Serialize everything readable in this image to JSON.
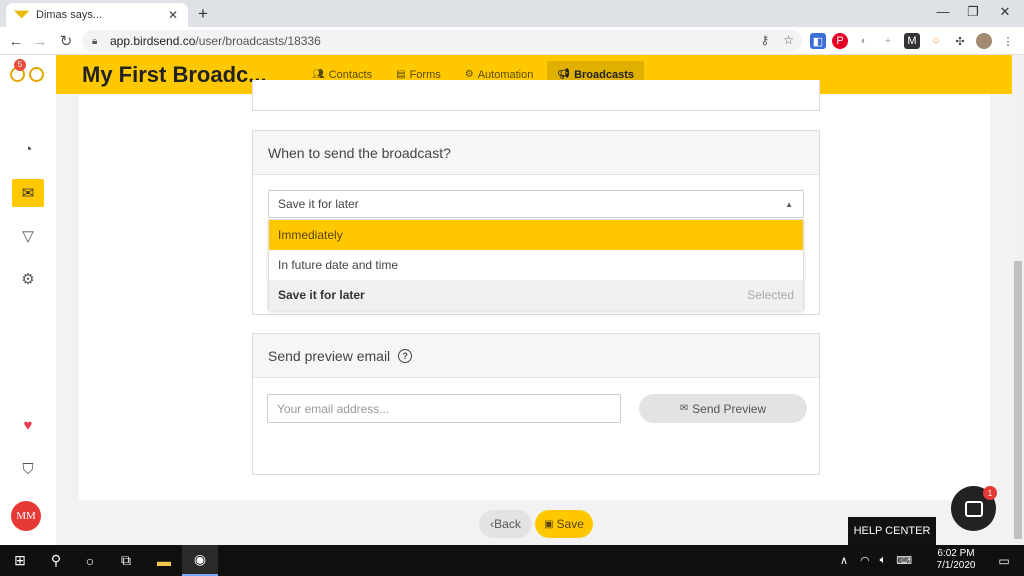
{
  "browser": {
    "tab_title": "Dimas says...",
    "tab_close": "✕",
    "new_tab": "+",
    "url_host": "app.birdsend.co",
    "url_path": "/user/broadcasts/18336",
    "window_controls": [
      "—",
      "❐",
      "✕"
    ]
  },
  "app": {
    "title": "My First Broadc...",
    "logo_badge": "5",
    "nav": [
      {
        "label": "Contacts",
        "icon": "contacts-icon",
        "active": false
      },
      {
        "label": "Forms",
        "icon": "forms-icon",
        "active": false
      },
      {
        "label": "Automation",
        "icon": "automation-icon",
        "active": false
      },
      {
        "label": "Broadcasts",
        "icon": "megaphone-icon",
        "active": true
      }
    ],
    "sidebar": {
      "icons": [
        "dashboard-icon",
        "mail-icon",
        "filter-icon",
        "settings-icon",
        "heart-icon",
        "shirt-icon"
      ],
      "avatar_initials": "MM"
    }
  },
  "schedule": {
    "heading": "When to send the broadcast?",
    "selected_value": "Save it for later",
    "options": [
      {
        "label": "Immediately",
        "state": "highlighted"
      },
      {
        "label": "In future date and time",
        "state": "normal"
      },
      {
        "label": "Save it for later",
        "state": "selected"
      }
    ],
    "selected_tag": "Selected"
  },
  "preview": {
    "heading": "Send preview email",
    "email_placeholder": "Your email address...",
    "send_button": "Send Preview"
  },
  "footer": {
    "back_label": "Back",
    "save_label": "Save"
  },
  "support": {
    "help_center": "HELP CENTER",
    "chat_badge": "1"
  },
  "taskbar": {
    "time": "6:02 PM",
    "date": "7/1/2020"
  },
  "colors": {
    "brand_yellow": "#ffc800",
    "avatar_red": "#e53935"
  }
}
